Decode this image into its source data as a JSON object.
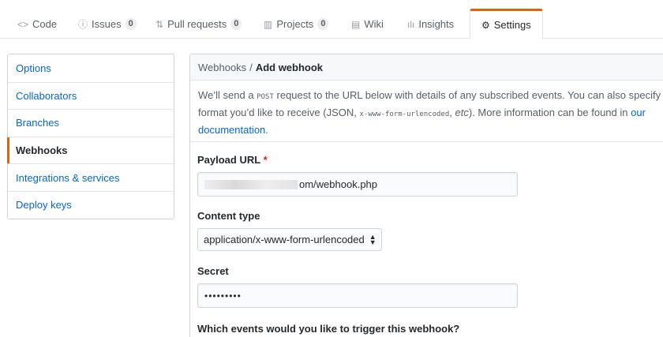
{
  "tabs": [
    {
      "label": "Code",
      "icon": "code-icon",
      "glyph": "<>"
    },
    {
      "label": "Issues",
      "icon": "issue-icon",
      "glyph": "ⓘ",
      "count": "0"
    },
    {
      "label": "Pull requests",
      "icon": "pull-request-icon",
      "glyph": "⇅",
      "count": "0"
    },
    {
      "label": "Projects",
      "icon": "project-icon",
      "glyph": "▥",
      "count": "0"
    },
    {
      "label": "Wiki",
      "icon": "book-icon",
      "glyph": "▤"
    },
    {
      "label": "Insights",
      "icon": "graph-icon",
      "glyph": "ılı"
    },
    {
      "label": "Settings",
      "icon": "gear-icon",
      "glyph": "⚙",
      "active": true
    }
  ],
  "sidebar": {
    "items": [
      {
        "label": "Options"
      },
      {
        "label": "Collaborators"
      },
      {
        "label": "Branches"
      },
      {
        "label": "Webhooks",
        "selected": true
      },
      {
        "label": "Integrations & services"
      },
      {
        "label": "Deploy keys"
      }
    ]
  },
  "header": {
    "crumb": "Webhooks",
    "separator": "/",
    "title": "Add webhook"
  },
  "intro": {
    "line1_a": "We’ll send a",
    "post": "POST",
    "line1_b": "request to the URL below with details of any subscribed events. You can also specify",
    "line2_a": "format you’d like to receive (JSON,",
    "urlencoded": "x-www-form-urlencoded",
    "comma": ",",
    "etc": "etc",
    "line2_b": "). More information can be found in",
    "our": "our",
    "documentation": "documentation",
    "period": "."
  },
  "form": {
    "payload_label": "Payload URL",
    "required_mark": "*",
    "payload_value": "om/webhook.php",
    "content_type_label": "Content type",
    "content_type_value": "application/x-www-form-urlencoded",
    "secret_label": "Secret",
    "secret_value": "•••••••••",
    "events_label": "Which events would you like to trigger this webhook?"
  },
  "colors": {
    "accent": "#e36209",
    "link": "#0366d6",
    "required": "#cb2431"
  }
}
